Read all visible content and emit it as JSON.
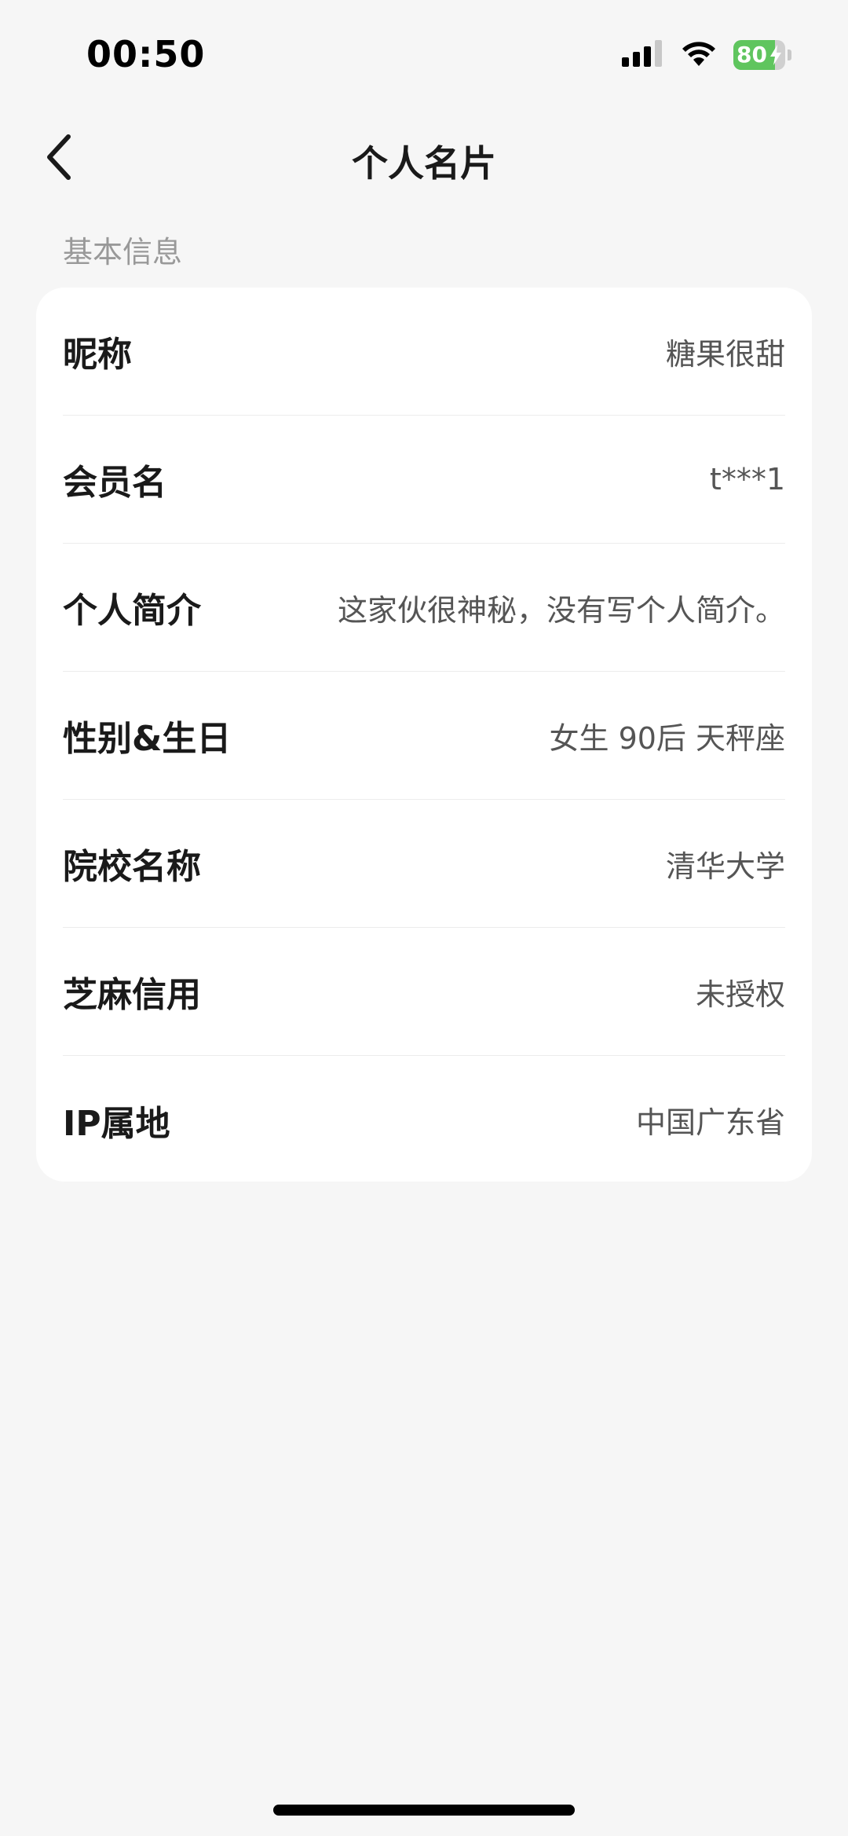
{
  "status_bar": {
    "time": "00:50",
    "battery_level": "80",
    "battery_fraction": 0.8,
    "signal_bars": 3,
    "signal_icon": "cellular-signal-icon",
    "wifi_icon": "wifi-icon",
    "battery_icon": "battery-charging-icon"
  },
  "nav": {
    "back_icon": "chevron-left-icon",
    "title": "个人名片"
  },
  "section": {
    "label": "基本信息"
  },
  "rows": [
    {
      "label": "昵称",
      "value": "糖果很甜"
    },
    {
      "label": "会员名",
      "value": "t***1"
    },
    {
      "label": "个人简介",
      "value": "这家伙很神秘，没有写个人简介。"
    },
    {
      "label": "性别&生日",
      "value": "女生 90后 天秤座"
    },
    {
      "label": "院校名称",
      "value": "清华大学"
    },
    {
      "label": "芝麻信用",
      "value": "未授权"
    },
    {
      "label": "IP属地",
      "value": "中国广东省"
    }
  ],
  "colors": {
    "background": "#f6f6f6",
    "card": "#ffffff",
    "battery_green": "#5fc55e",
    "section_label": "#999999",
    "value_text": "#555555"
  }
}
